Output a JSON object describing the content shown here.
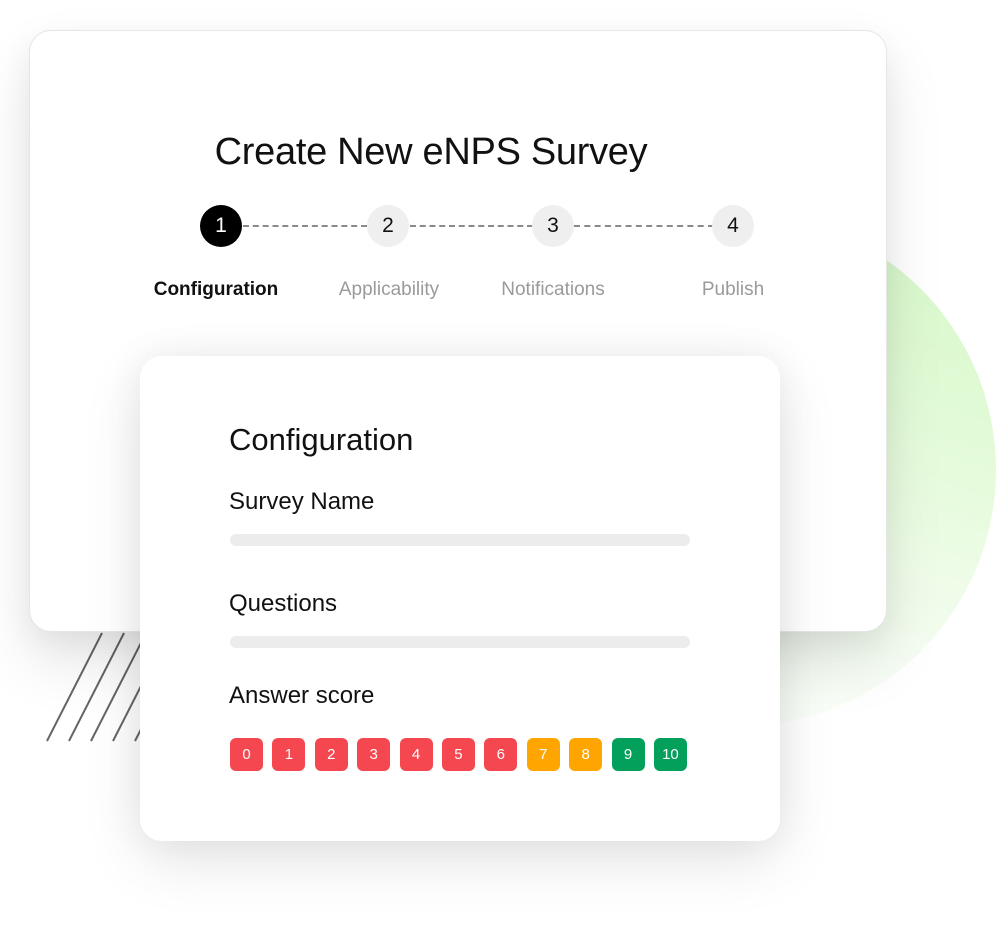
{
  "dialog": {
    "title": "Create New eNPS Survey"
  },
  "stepper": {
    "steps": [
      {
        "number": "1",
        "label": "Configuration",
        "active": true
      },
      {
        "number": "2",
        "label": "Applicability",
        "active": false
      },
      {
        "number": "3",
        "label": "Notifications",
        "active": false
      },
      {
        "number": "4",
        "label": "Publish",
        "active": false
      }
    ]
  },
  "form": {
    "section_title": "Configuration",
    "survey_name_label": "Survey Name",
    "survey_name_value": "",
    "questions_label": "Questions",
    "questions_value": "",
    "answer_score_label": "Answer score",
    "scores": [
      {
        "value": "0",
        "category": "detractor"
      },
      {
        "value": "1",
        "category": "detractor"
      },
      {
        "value": "2",
        "category": "detractor"
      },
      {
        "value": "3",
        "category": "detractor"
      },
      {
        "value": "4",
        "category": "detractor"
      },
      {
        "value": "5",
        "category": "detractor"
      },
      {
        "value": "6",
        "category": "detractor"
      },
      {
        "value": "7",
        "category": "passive"
      },
      {
        "value": "8",
        "category": "passive"
      },
      {
        "value": "9",
        "category": "promoter"
      },
      {
        "value": "10",
        "category": "promoter"
      }
    ]
  },
  "colors": {
    "detractor": "#F5474F",
    "passive": "#FFA500",
    "promoter": "#03A05B",
    "step_active": "#000000",
    "step_inactive": "#EFEFEF"
  }
}
